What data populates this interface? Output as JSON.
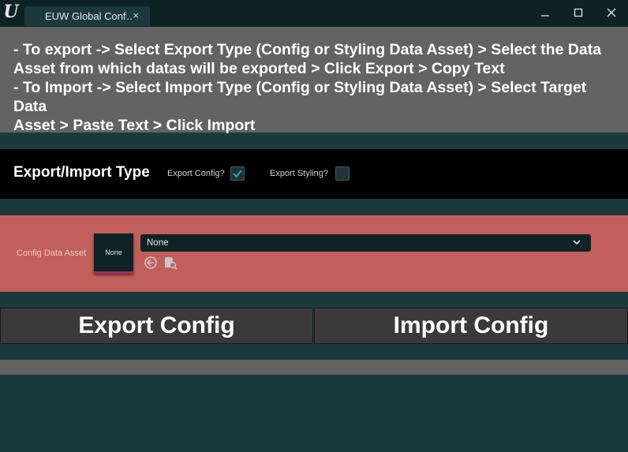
{
  "window": {
    "logo": "U",
    "tab_title": "EUW Global Conf…",
    "tab_close": "×",
    "minimize": "—",
    "maximize": "☐",
    "close": "✕"
  },
  "instructions": {
    "lines": [
      "- To export -> Select Export Type (Config or Styling Data Asset) > Select the Data",
      "Asset from which datas will be exported > Click Export > Copy Text",
      "- To Import -> Select Import Type (Config or Styling Data Asset) > Select Target Data",
      "Asset > Paste Text > Click Import"
    ]
  },
  "type_panel": {
    "title": "Export/Import Type",
    "export_config_label": "Export Config?",
    "export_config_checked": true,
    "export_styling_label": "Export Styling?",
    "export_styling_checked": false
  },
  "asset_panel": {
    "label": "Config Data Asset",
    "thumbnail_text": "None",
    "selected_asset": "None",
    "icons": [
      "browse-to-asset-icon",
      "use-selected-asset-icon"
    ]
  },
  "buttons": {
    "export": "Export Config",
    "import": "Import Config"
  },
  "colors": {
    "background": "#1c3a3d",
    "instructions_bg": "#636363",
    "asset_panel_bg": "#c15f5c",
    "checkbox_accent": "#2fa0d8",
    "button_bg": "#3a3a3a"
  }
}
